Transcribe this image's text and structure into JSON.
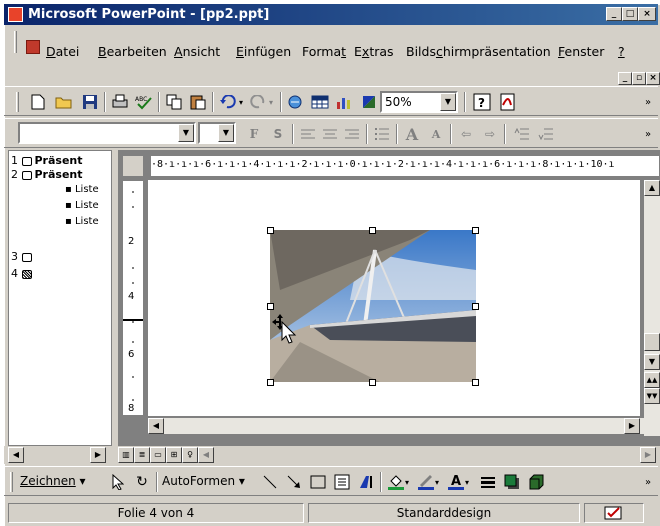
{
  "window": {
    "title": "Microsoft PowerPoint - [pp2.ppt]"
  },
  "menu": {
    "items": [
      {
        "pre": "",
        "u": "D",
        "post": "atei"
      },
      {
        "pre": "",
        "u": "B",
        "post": "earbeiten"
      },
      {
        "pre": "",
        "u": "A",
        "post": "nsicht"
      },
      {
        "pre": "",
        "u": "E",
        "post": "infügen"
      },
      {
        "pre": "Forma",
        "u": "t",
        "post": ""
      },
      {
        "pre": "E",
        "u": "x",
        "post": "tras"
      },
      {
        "pre": "Bilds",
        "u": "c",
        "post": "hirmpräsentation"
      },
      {
        "pre": "",
        "u": "F",
        "post": "enster"
      },
      {
        "pre": "",
        "u": "?",
        "post": ""
      }
    ]
  },
  "toolbar": {
    "zoom": "50%"
  },
  "formatting": {
    "font": "",
    "size": "",
    "bold": "F",
    "shadow": "S"
  },
  "outline": {
    "rows": [
      {
        "num": "1",
        "text": "Präsent"
      },
      {
        "num": "2",
        "text": "Präsent"
      },
      {
        "num": "",
        "text": "Liste"
      },
      {
        "num": "",
        "text": "Liste"
      },
      {
        "num": "",
        "text": "Liste"
      },
      {
        "num": "3",
        "text": ""
      },
      {
        "num": "4",
        "text": ""
      }
    ]
  },
  "ruler": {
    "horizontal": "·8·ı·ı·ı·6·ı·ı·ı·4·ı·ı·ı·2·ı·ı·ı·0·ı·ı·ı·2·ı·ı·ı·4·ı·ı·ı·6·ı·ı·ı·8·ı·ı·ı·10·ı",
    "vertical": [
      "2",
      "4",
      "6",
      "8"
    ]
  },
  "drawbar": {
    "draw": "Zeichnen",
    "autoshapes": "AutoFormen"
  },
  "status": {
    "slide": "Folie 4 von 4",
    "design": "Standarddesign"
  },
  "colors": {
    "titlebar": "#0a246a",
    "accent": "#3a6ea5",
    "face": "#d4d0c8"
  }
}
